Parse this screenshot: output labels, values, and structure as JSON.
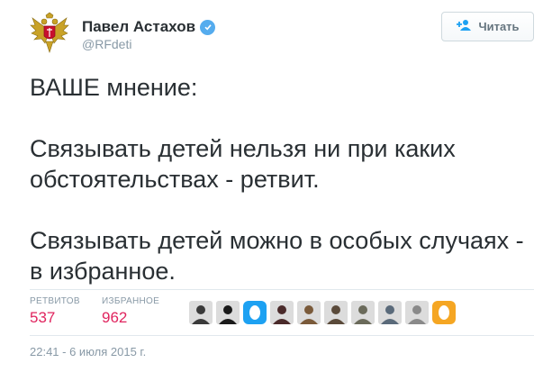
{
  "author": {
    "name": "Павел Астахов",
    "handle": "@RFdeti",
    "verified": true
  },
  "follow_button": {
    "label": "Читать",
    "icon": "add-user-icon"
  },
  "tweet": {
    "paragraphs": [
      "ВАШЕ мнение:",
      "Связывать детей нельзя ни при каких обстоятельствах - ретвит.",
      "Связывать детей можно в особых случаях - в избранное."
    ]
  },
  "stats": {
    "retweets_label": "РЕТВИТОВ",
    "retweets_count": "537",
    "favorites_label": "ИЗБРАННОЕ",
    "favorites_count": "962"
  },
  "likers": [
    {
      "kind": "photo-group",
      "color": "#3a3a3a"
    },
    {
      "kind": "photo-dark",
      "color": "#1a1a1a"
    },
    {
      "kind": "default-egg",
      "color": "#1da1f2"
    },
    {
      "kind": "photo",
      "color": "#4a2a2a"
    },
    {
      "kind": "photo",
      "color": "#7a5a3a"
    },
    {
      "kind": "photo",
      "color": "#5a4a3a"
    },
    {
      "kind": "photo",
      "color": "#6a6a5a"
    },
    {
      "kind": "photo",
      "color": "#5a6a7a"
    },
    {
      "kind": "photo",
      "color": "#8a8a8a"
    },
    {
      "kind": "default-egg",
      "color": "#f5a623"
    }
  ],
  "timestamp": "22:41 - 6 июля 2015 г.",
  "colors": {
    "count": "#e0245e",
    "muted": "#8899a6",
    "text": "#292f33",
    "verified": "#55acee"
  }
}
